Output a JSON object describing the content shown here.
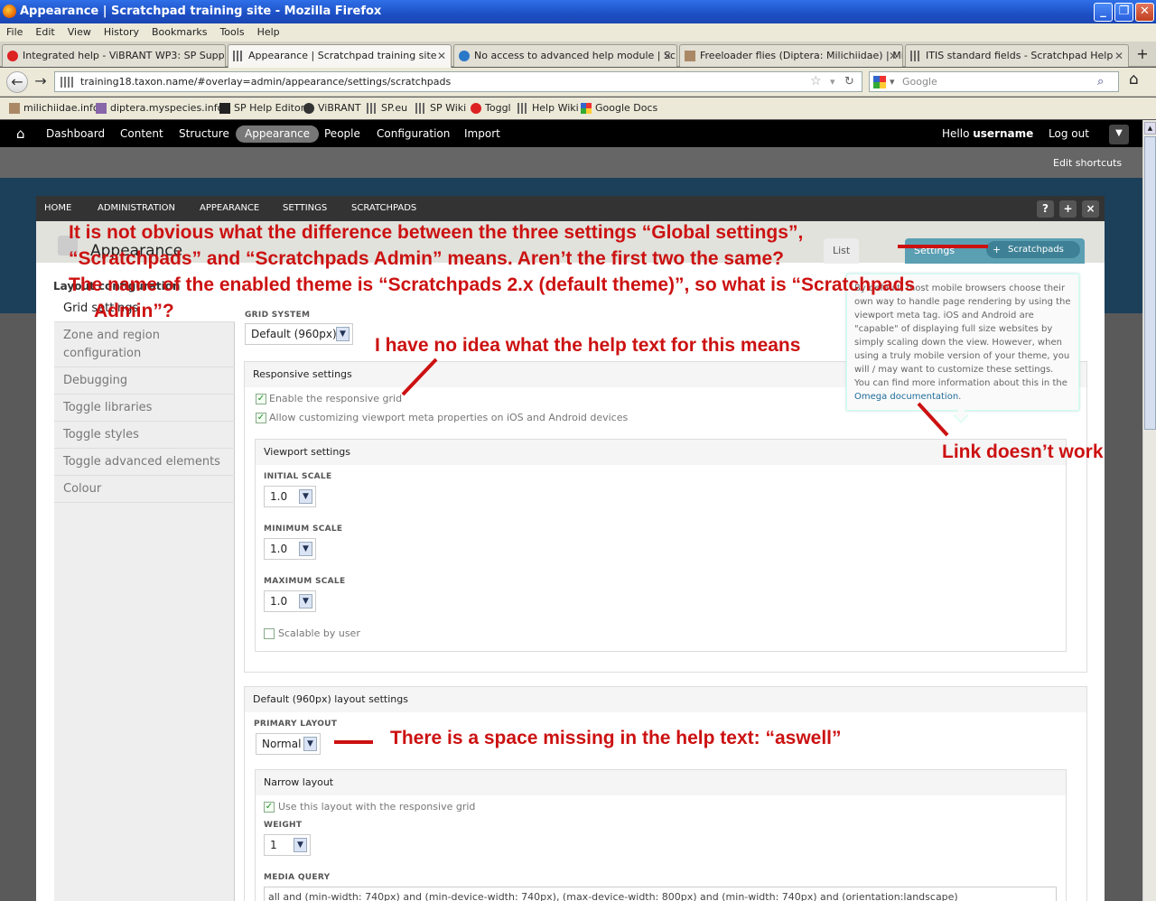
{
  "window": {
    "title": "Appearance | Scratchpad training site - Mozilla Firefox",
    "min": "_",
    "max": "❐",
    "close": "✕"
  },
  "menu": [
    "File",
    "Edit",
    "View",
    "History",
    "Bookmarks",
    "Tools",
    "Help"
  ],
  "tabs": [
    {
      "label": "Integrated help - ViBRANT WP3: SP Supp...",
      "active": false
    },
    {
      "label": "Appearance | Scratchpad training site",
      "active": true
    },
    {
      "label": "No access to advanced help module | Scr...",
      "active": false
    },
    {
      "label": "Freeloader flies (Diptera: Milichiidae) | Mili...",
      "active": false
    },
    {
      "label": "ITIS standard fields - Scratchpad Help",
      "active": false
    }
  ],
  "tab_new": "+",
  "nav": {
    "url": "training18.taxon.name/#overlay=admin/appearance/settings/scratchpads",
    "search_placeholder": "Google"
  },
  "bookmarks": [
    "milichiidae.info",
    "diptera.myspecies.info",
    "SP Help Editor",
    "ViBRANT",
    "SP.eu",
    "SP Wiki",
    "Toggl",
    "Help Wiki",
    "Google Docs"
  ],
  "toolbar": {
    "items": [
      "Dashboard",
      "Content",
      "Structure",
      "Appearance",
      "People",
      "Configuration",
      "Import"
    ],
    "hello": "Hello",
    "username": "username",
    "logout": "Log out",
    "edit_shortcuts": "Edit shortcuts"
  },
  "breadcrumb": [
    "HOME",
    "ADMINISTRATION",
    "APPEARANCE",
    "SETTINGS",
    "SCRATCHPADS"
  ],
  "overlay_buttons": [
    "?",
    "+",
    "×"
  ],
  "page": {
    "title": "Appearance",
    "tabs": [
      "List",
      "Settings"
    ],
    "subtab": "Scratchpads",
    "section_label": "Layout configuration",
    "vtabs": [
      "Grid settings",
      "Zone and region configuration",
      "Debugging",
      "Toggle libraries",
      "Toggle styles",
      "Toggle advanced elements",
      "Colour"
    ]
  },
  "form": {
    "grid_system_label": "GRID SYSTEM",
    "grid_system_value": "Default (960px)",
    "responsive_title": "Responsive settings",
    "enable_responsive": "Enable the responsive grid",
    "allow_viewport": "Allow customizing viewport meta properties on iOS and Android devices",
    "viewport_title": "Viewport settings",
    "initial_scale_label": "INITIAL SCALE",
    "initial_scale": "1.0",
    "minimum_scale_label": "MINIMUM SCALE",
    "minimum_scale": "1.0",
    "maximum_scale_label": "MAXIMUM SCALE",
    "maximum_scale": "1.0",
    "scalable_label": "Scalable by user",
    "layout_title": "Default (960px) layout settings",
    "primary_layout_label": "PRIMARY LAYOUT",
    "primary_layout": "Normal",
    "narrow_title": "Narrow layout",
    "use_layout": "Use this layout with the responsive grid",
    "weight_label": "WEIGHT",
    "weight": "1",
    "media_query_label": "MEDIA QUERY",
    "media_query": "all and (min-width: 740px) and (min-device-width: 740px), (max-device-width: 800px) and (min-width: 740px) and (orientation:landscape)"
  },
  "tooltip": {
    "text": "By default, most mobile browsers choose their own way to handle page rendering by using the viewport meta tag. iOS and Android are \"capable\" of displaying full size websites by simply scaling down the view. However, when using a truly mobile version of your theme, you will / may want to customize these settings. You can find more information about this in the",
    "link": "Omega documentation",
    "end": "."
  },
  "annotations": {
    "a1": "It is not obvious what the difference between the three settings “Global settings”,",
    "a2": "“Scratchpads” and “Scratchpads Admin” means. Aren’t the first two the same?",
    "a3": "The name of the enabled theme is “Scratchpads 2.x (default theme)”, so what is “Scratchpads",
    "a4": "Admin”?",
    "help": "I have no idea what the help text for this means",
    "link": "Link doesn’t work",
    "space": "There is a space missing in the help text: “aswell”"
  },
  "colors": {
    "annotation": "#cc1111",
    "toolbar": "#000000",
    "titlebar": "#2358d8"
  }
}
